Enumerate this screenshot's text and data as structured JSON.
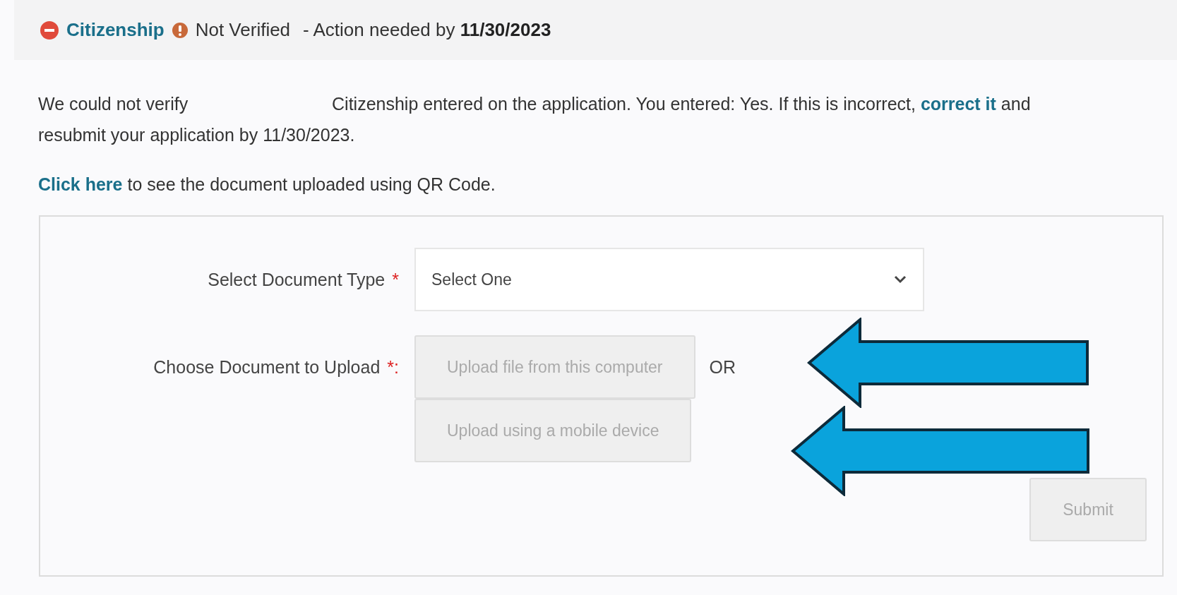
{
  "header": {
    "section": "Citizenship",
    "status": "Not Verified",
    "action": "- Action needed by **11/30/2023**"
  },
  "message": {
    "text_before": "We could not verify",
    "text_after": "Citizenship entered on the application. You entered: Yes. If this is incorrect,",
    "link": "correct it",
    "text_end": "and resubmit your application by 11/30/2023."
  },
  "qr_note": {
    "link": "Click here",
    "text": "to see the document uploaded using QR Code."
  },
  "form": {
    "fields": [
      {
        "kind": "select",
        "label": "Select Document Type",
        "required_mark": "*",
        "value": "Select One"
      },
      {
        "kind": "upload",
        "label": "Choose Document to Upload",
        "required_mark": "*:",
        "separator": "OR",
        "buttons": [
          {
            "label": "Upload file from this computer",
            "disabled": true
          },
          {
            "label": "Upload using a mobile device",
            "disabled": true
          }
        ]
      }
    ],
    "submit": {
      "label": "Submit",
      "disabled": true
    }
  }
}
